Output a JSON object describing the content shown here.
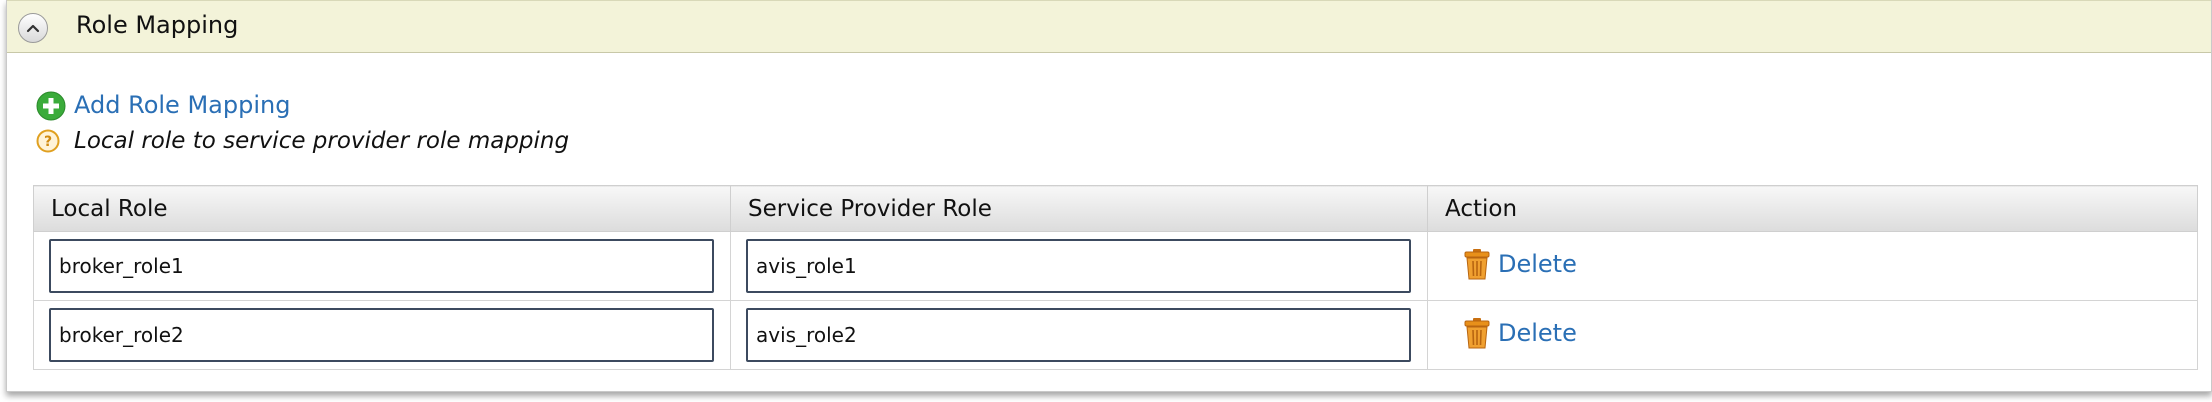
{
  "panel": {
    "title": "Role Mapping",
    "add_link": "Add Role Mapping",
    "help_text": "Local role to service provider role mapping"
  },
  "table": {
    "headers": [
      "Local Role",
      "Service Provider Role",
      "Action"
    ],
    "rows": [
      {
        "local_role": "broker_role1",
        "sp_role": "avis_role1",
        "action": "Delete"
      },
      {
        "local_role": "broker_role2",
        "sp_role": "avis_role2",
        "action": "Delete"
      }
    ]
  },
  "icons": {
    "collapse": "chevron-up-icon",
    "add": "plus-circle-icon",
    "help": "question-circle-icon",
    "delete": "trash-icon"
  },
  "colors": {
    "header_bg": "#f3f3d9",
    "link": "#2a6fb5",
    "add_icon": "#3aab3a",
    "help_icon": "#e0a020",
    "trash_icon": "#e8901a"
  }
}
